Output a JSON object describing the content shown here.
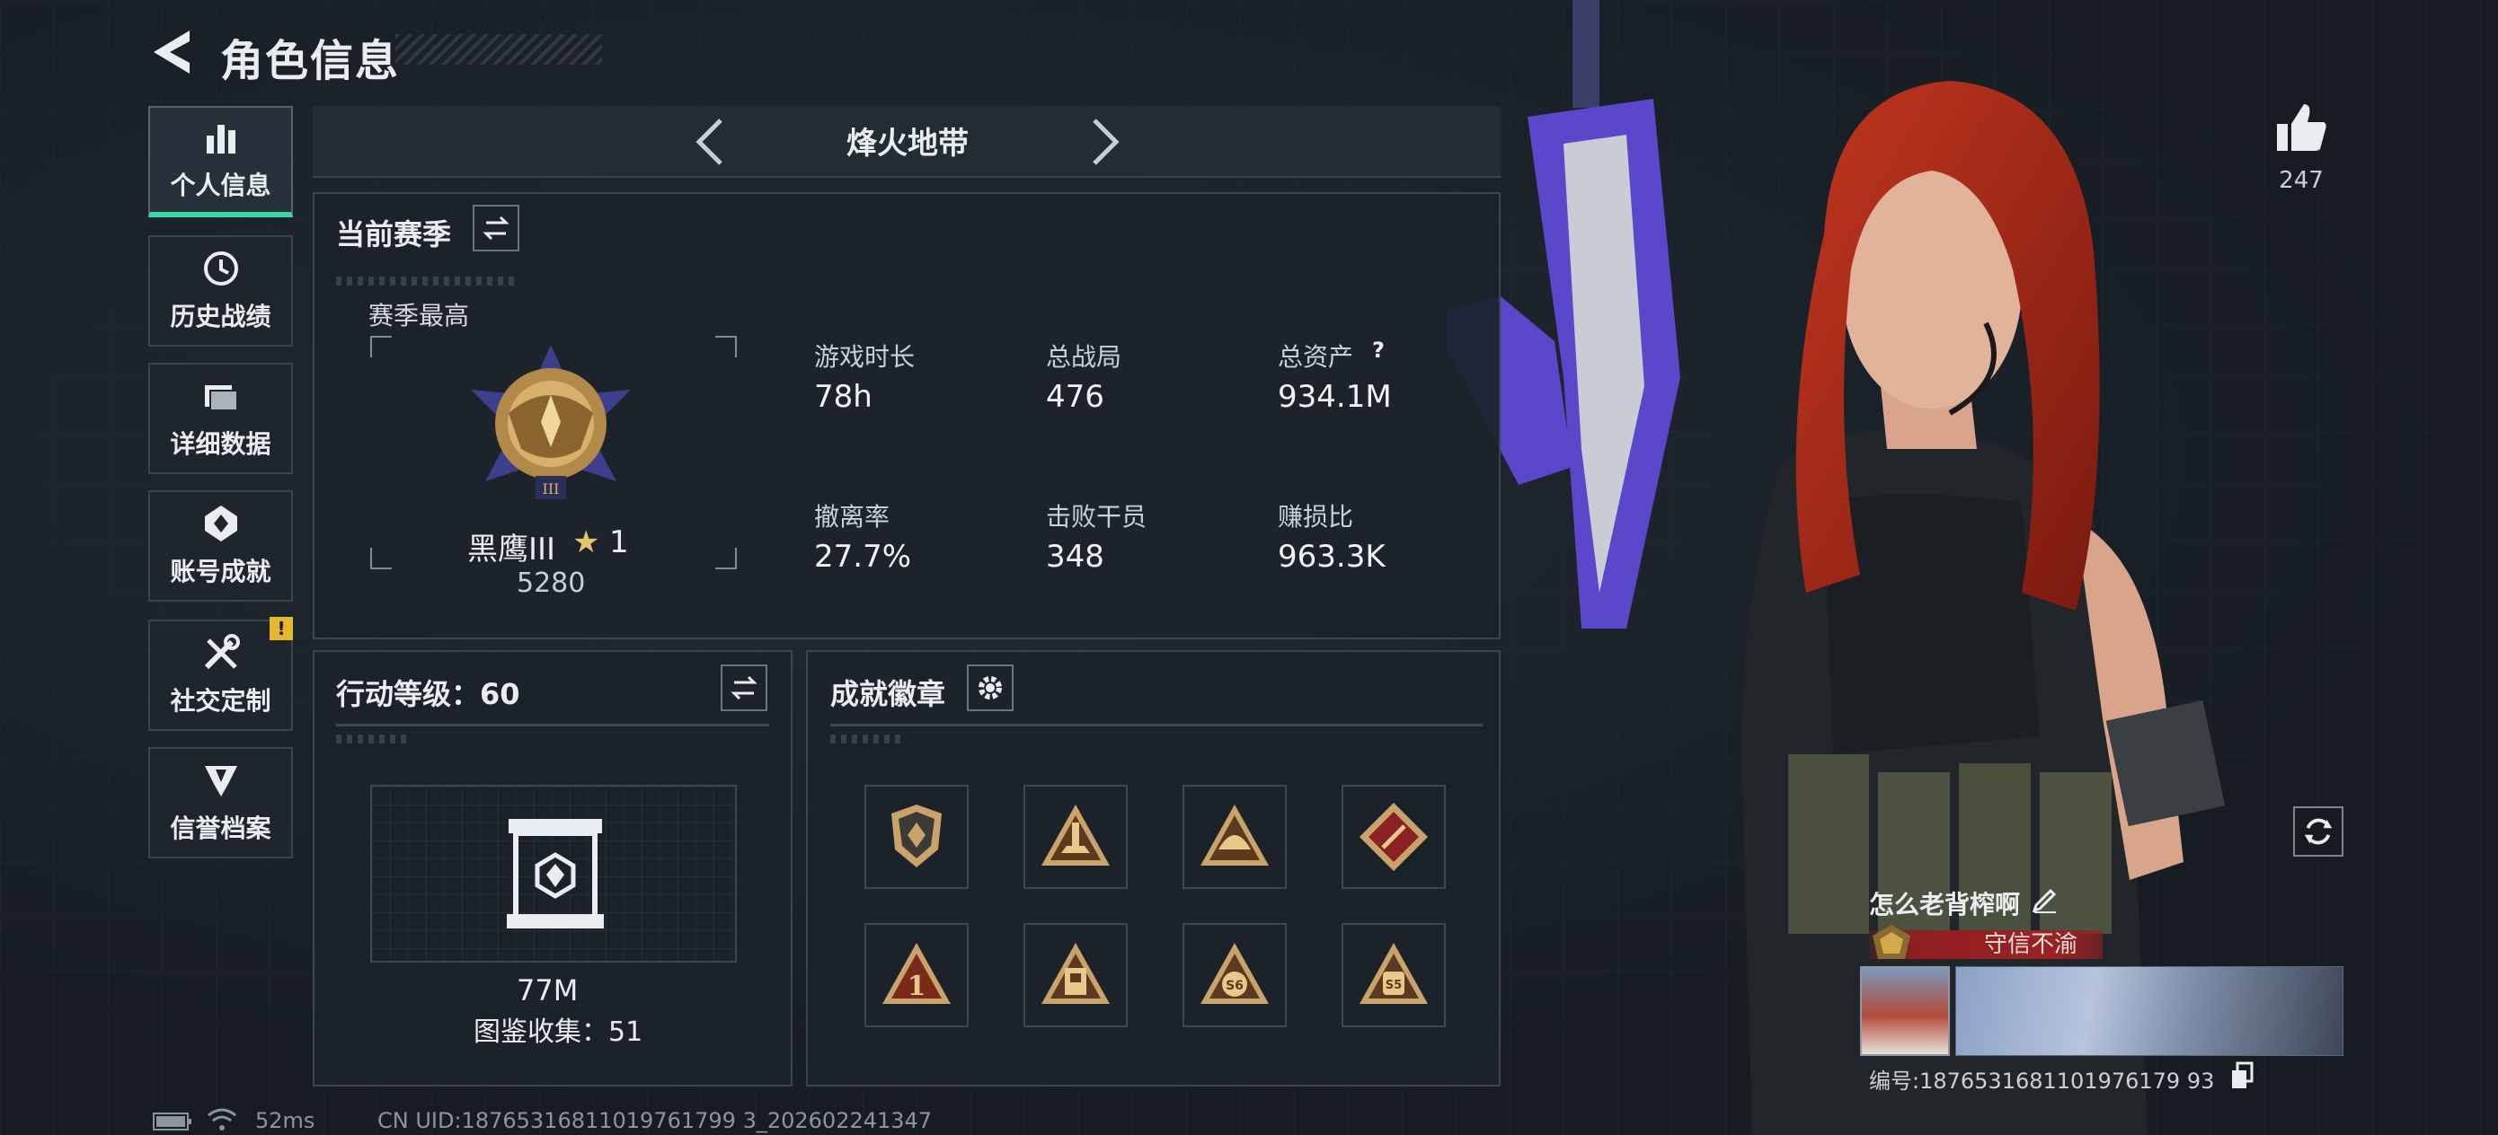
{
  "header": {
    "title": "角色信息"
  },
  "sidebar": {
    "items": [
      {
        "label": "个人信息",
        "icon": "bar-chart-icon",
        "active": true
      },
      {
        "label": "历史战绩",
        "icon": "history-icon"
      },
      {
        "label": "详细数据",
        "icon": "folder-icon"
      },
      {
        "label": "账号成就",
        "icon": "achievement-icon"
      },
      {
        "label": "社交定制",
        "icon": "tools-icon",
        "badge": "!"
      },
      {
        "label": "信誉档案",
        "icon": "emblem-icon"
      }
    ]
  },
  "mode_selector": {
    "current": "烽火地带"
  },
  "season": {
    "title": "当前赛季",
    "best_label": "赛季最高",
    "rank_name": "黑鹰III",
    "rank_star": "★",
    "rank_level": "1",
    "rank_score": "5280",
    "stats": [
      {
        "label": "游戏时长",
        "value": "78h"
      },
      {
        "label": "总战局",
        "value": "476"
      },
      {
        "label": "总资产",
        "value": "934.1M",
        "help": "?"
      },
      {
        "label": "撤离率",
        "value": "27.7%"
      },
      {
        "label": "击败干员",
        "value": "348"
      },
      {
        "label": "赚损比",
        "value": "963.3K"
      }
    ]
  },
  "action_level": {
    "title": "行动等级：60",
    "collection_value": "77M",
    "collection_label": "图鉴收集：51"
  },
  "achievements": {
    "title": "成就徽章",
    "badges": [
      "shield-badge-icon",
      "rocket-badge-icon",
      "helmet-badge-icon",
      "red-diamond-badge-icon",
      "number-one-badge-icon",
      "building-badge-icon",
      "s6-badge-icon",
      "s5-badge-icon"
    ]
  },
  "player": {
    "like_count": "247",
    "name": "怎么老背榨啊",
    "honor_title": "守信不渝",
    "id_text": "编号:1876531681101976179 93"
  },
  "footer": {
    "ping": "52ms",
    "uid": "CN UID:18765316811019761799 3_202602241347"
  },
  "colors": {
    "accent": "#3ad8a4",
    "warning": "#e8b52e",
    "honor_red": "#9b2222",
    "gold": "#d4a94a"
  }
}
